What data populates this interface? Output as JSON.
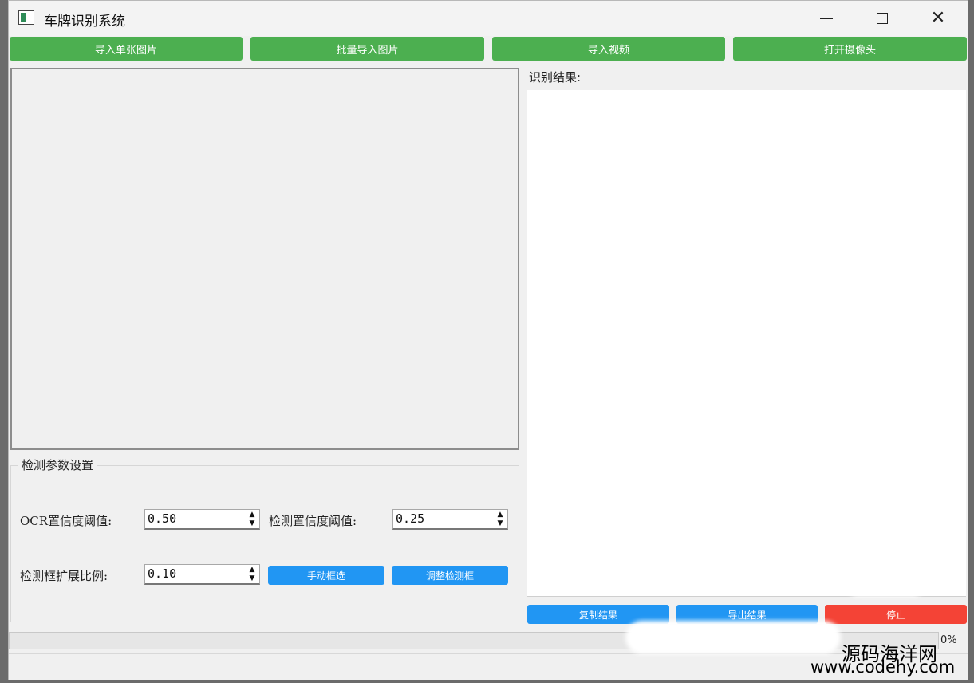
{
  "window": {
    "title": "车牌识别系统",
    "icons": {
      "app": "app-window-icon",
      "minimize": "minimize-icon",
      "maximize": "maximize-icon",
      "close": "close-icon"
    },
    "close_glyph": "✕"
  },
  "toolbar": {
    "import_single": "导入单张图片",
    "batch_import": "批量导入图片",
    "import_video": "导入视频",
    "open_camera": "打开摄像头"
  },
  "results": {
    "label": "识别结果:",
    "text": ""
  },
  "params": {
    "group_title": "检测参数设置",
    "ocr_conf_label": "OCR置信度阈值:",
    "ocr_conf_value": "0.50",
    "det_conf_label": "检测置信度阈值:",
    "det_conf_value": "0.25",
    "box_expand_label": "检测框扩展比例:",
    "box_expand_value": "0.10",
    "manual_select": "手动框选",
    "adjust_box": "调整检测框",
    "spin_up": "▲",
    "spin_down": "▼"
  },
  "actions": {
    "copy_result": "复制结果",
    "export_result": "导出结果",
    "stop": "停止"
  },
  "progress": {
    "value": 0,
    "text": "0%"
  },
  "watermark": {
    "name": "源码海洋网",
    "url": "www.codehy.com"
  },
  "colors": {
    "green_button": "#4caf50",
    "blue_button": "#2196f3",
    "red_button": "#f44336"
  }
}
